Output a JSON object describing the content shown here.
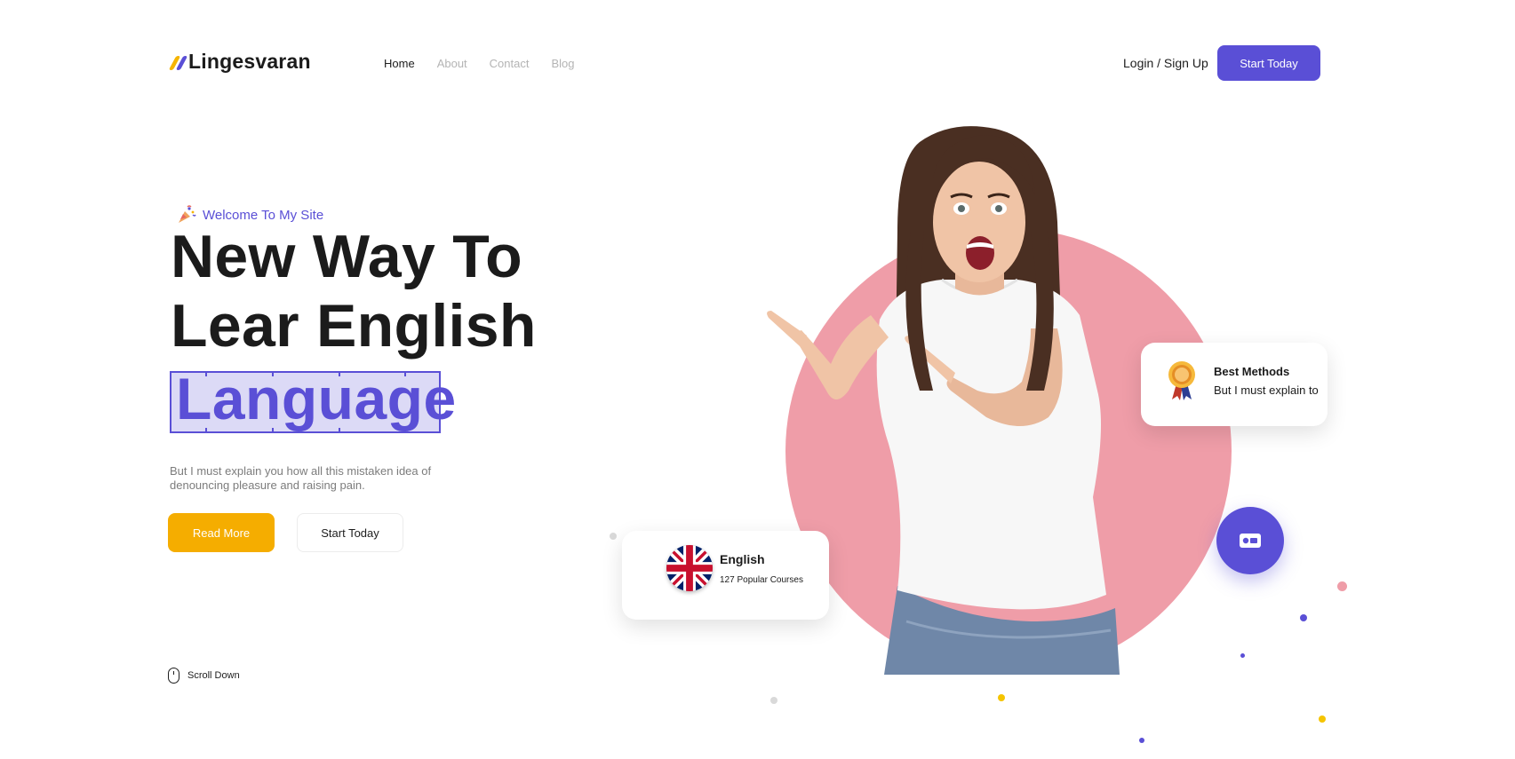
{
  "brand": {
    "name": "Lingesvaran",
    "colors": {
      "primary": "#5a4fd6",
      "accent": "#f5ad00",
      "pink": "#ef9da8"
    }
  },
  "nav": {
    "items": [
      {
        "label": "Home",
        "active": true
      },
      {
        "label": "About",
        "active": false
      },
      {
        "label": "Contact",
        "active": false
      },
      {
        "label": "Blog",
        "active": false
      }
    ]
  },
  "header": {
    "login_label": "Login / Sign Up",
    "start_label": "Start Today"
  },
  "hero": {
    "welcome": "Welcome To My Site",
    "welcome_icon": "party-popper-icon",
    "headline_line1": "New Way To",
    "headline_line2": "Lear English",
    "headline_highlight": "Language",
    "description": "But I must explain you how all this mistaken idea of denouncing pleasure and raising pain.",
    "read_more_label": "Read More",
    "start_label": "Start Today",
    "scroll_label": "Scroll Down"
  },
  "cards": {
    "english": {
      "title": "English",
      "subtitle": "127 Popular Courses",
      "icon": "uk-flag-icon"
    },
    "methods": {
      "title": "Best Methods",
      "subtitle": "But I must explain to",
      "icon": "medal-icon"
    },
    "action_icon": "id-card-icon"
  }
}
